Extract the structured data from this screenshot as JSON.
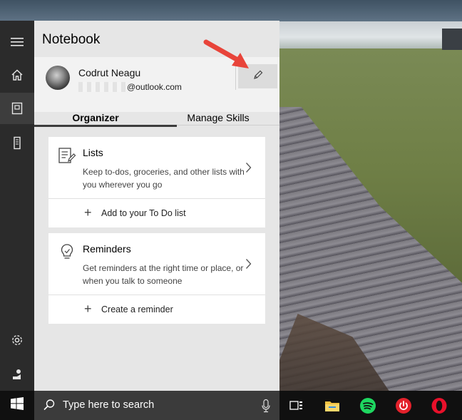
{
  "notebook": {
    "title": "Notebook",
    "user": {
      "name": "Codrut Neagu",
      "email_suffix": "@outlook.com"
    },
    "tabs": [
      "Organizer",
      "Manage Skills"
    ],
    "active_tab": "Organizer"
  },
  "cards": [
    {
      "title": "Lists",
      "description": "Keep to-dos, groceries, and other lists with you wherever you go",
      "action": "Add to your To Do list",
      "icon": "list-icon"
    },
    {
      "title": "Reminders",
      "description": "Get reminders at the right time or place, or when you talk to someone",
      "action": "Create a reminder",
      "icon": "lightbulb-icon"
    }
  ],
  "rail": {
    "items": [
      "hamburger-icon",
      "home-icon",
      "notebook-icon",
      "device-icon",
      "settings-icon",
      "feedback-icon"
    ],
    "active": "notebook-icon"
  },
  "taskbar": {
    "search_placeholder": "Type here to search",
    "apps": [
      "task-view-icon",
      "file-explorer-icon",
      "spotify-icon",
      "power-icon",
      "opera-icon"
    ]
  },
  "colors": {
    "annotation_arrow": "#e8443a",
    "rail_bg": "#2b2b2b",
    "panel_bg": "#e6e6e6",
    "taskbar_bg": "#101010"
  }
}
